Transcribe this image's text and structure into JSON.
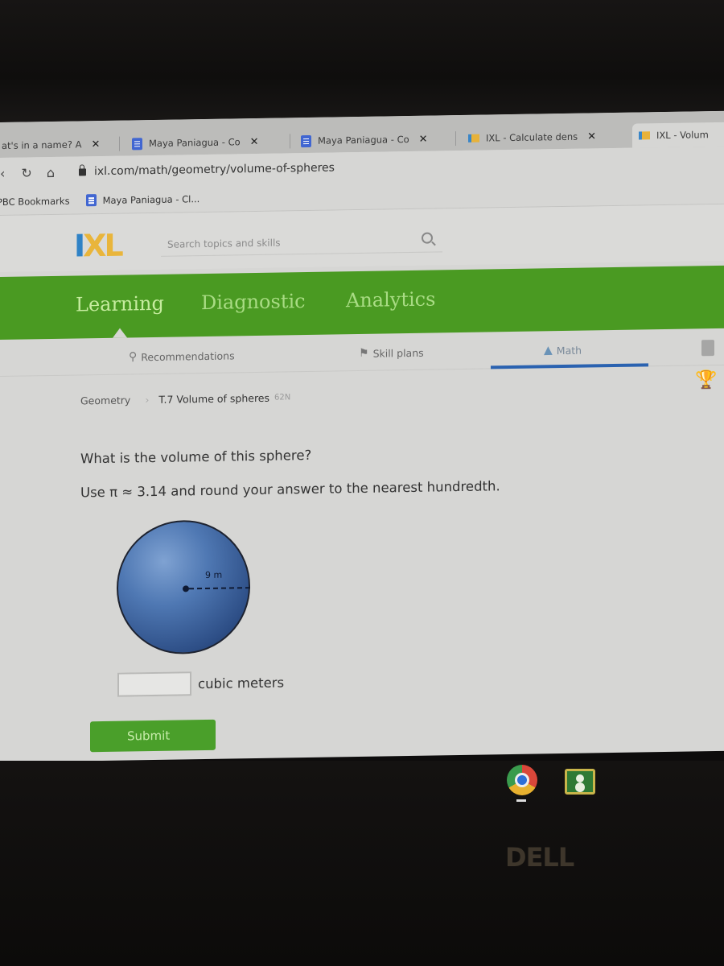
{
  "browser": {
    "tabs": [
      {
        "title": "at's in a name? A",
        "favicon": "generic",
        "active": false
      },
      {
        "title": "Maya Paniagua - Co",
        "favicon": "google-docs-icon",
        "active": false
      },
      {
        "title": "Maya Paniagua - Co",
        "favicon": "google-docs-icon",
        "active": false
      },
      {
        "title": "IXL - Calculate dens",
        "favicon": "ixl-icon",
        "active": false
      },
      {
        "title": "IXL - Volum",
        "favicon": "ixl-icon",
        "active": true
      }
    ],
    "close_glyph": "✕",
    "url": "ixl.com/math/geometry/volume-of-spheres",
    "bookmarks": [
      {
        "label": "PBC Bookmarks"
      },
      {
        "label": "Maya Paniagua - Cl..."
      }
    ]
  },
  "ixl": {
    "logo": {
      "i": "I",
      "xl": "XL"
    },
    "search_placeholder": "Search topics and skills",
    "main_nav": [
      {
        "label": "Learning",
        "active": true
      },
      {
        "label": "Diagnostic",
        "active": false
      },
      {
        "label": "Analytics",
        "active": false
      }
    ],
    "sub_nav": [
      {
        "label": "Recommendations",
        "icon": "recommendations-icon"
      },
      {
        "label": "Skill plans",
        "icon": "skill-plans-icon"
      },
      {
        "label": "Math",
        "icon": "pyramid-icon",
        "active": true
      }
    ],
    "breadcrumb": {
      "parent": "Geometry",
      "separator": "›",
      "current": "T.7 Volume of spheres",
      "code": "62N"
    }
  },
  "problem": {
    "question": "What is the volume of this sphere?",
    "instruction": "Use π ≈ 3.14 and round your answer to the nearest hundredth.",
    "figure": {
      "shape": "sphere",
      "radius_label": "9 m",
      "radius_value": 9,
      "radius_unit": "m"
    },
    "answer": {
      "value": "",
      "unit": "cubic meters"
    },
    "submit_label": "Submit"
  },
  "device": {
    "dock": [
      "chrome-icon",
      "google-classroom-icon"
    ],
    "brand": "DELL"
  },
  "colors": {
    "ixl_green": "#4a9a22",
    "ixl_blue": "#2f82c6",
    "ixl_yellow": "#e9b53b",
    "math_tab_underline": "#2a62b0",
    "sphere_blue": "#4f78b3"
  }
}
